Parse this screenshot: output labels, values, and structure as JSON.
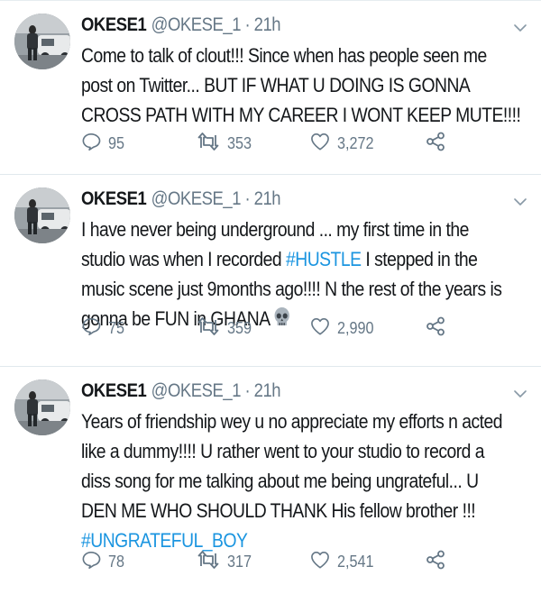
{
  "colors": {
    "text": "#14171a",
    "muted": "#657786",
    "link": "#1b95e0",
    "divider": "#e1e8ed"
  },
  "tweets": [
    {
      "name": "OKESE1",
      "handle": "@OKESE_1",
      "separator": "·",
      "time": "21h",
      "lines": [
        [
          {
            "text": "Come to talk of clout!!! Since when has people seen me"
          }
        ],
        [
          {
            "text": "post on Twitter... BUT IF WHAT U DOING IS GONNA"
          }
        ],
        [
          {
            "text": "CROSS PATH WITH MY CAREER I WONT KEEP MUTE!!!!"
          }
        ]
      ],
      "replies": "95",
      "retweets": "353",
      "likes": "3,272"
    },
    {
      "name": "OKESE1",
      "handle": "@OKESE_1",
      "separator": "·",
      "time": "21h",
      "lines": [
        [
          {
            "text": "I have never being underground ... my first time in the"
          }
        ],
        [
          {
            "text": "studio was when I recorded "
          },
          {
            "text": "#HUSTLE",
            "tag": true
          },
          {
            "text": " I stepped in the"
          }
        ],
        [
          {
            "text": "music scene just 9months ago!!!! N the rest of the years is"
          }
        ],
        [
          {
            "text": "gonna be FUN in GHANA"
          },
          {
            "emoji": "skull-emoji"
          }
        ]
      ],
      "replies": "75",
      "retweets": "359",
      "likes": "2,990"
    },
    {
      "name": "OKESE1",
      "handle": "@OKESE_1",
      "separator": "·",
      "time": "21h",
      "lines": [
        [
          {
            "text": "Years of friendship wey u no appreciate my efforts n acted"
          }
        ],
        [
          {
            "text": "like a dummy!!!! U rather went to your studio to record a"
          }
        ],
        [
          {
            "text": "diss song for me talking about me being ungrateful... U"
          }
        ],
        [
          {
            "text": "DEN ME WHO SHOULD THANK His fellow brother !!!"
          }
        ],
        [
          {
            "text": "#UNGRATEFUL_BOY",
            "tag": true
          }
        ]
      ],
      "replies": "78",
      "retweets": "317",
      "likes": "2,541"
    }
  ],
  "icons": {
    "reply": "reply-icon",
    "retweet": "retweet-icon",
    "like": "heart-icon",
    "share": "share-icon",
    "more": "chevron-down-icon"
  }
}
